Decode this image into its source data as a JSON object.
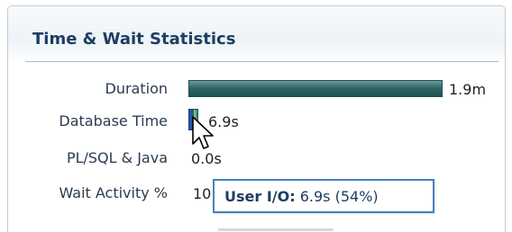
{
  "panel": {
    "title": "Time & Wait Statistics"
  },
  "rows": [
    {
      "label": "Duration",
      "value": "1.9m"
    },
    {
      "label": "Database Time",
      "value": "6.9s"
    },
    {
      "label": "PL/SQL & Java",
      "value": "0.0s"
    },
    {
      "label": "Wait Activity %",
      "value": "10"
    }
  ],
  "tooltip": {
    "label": "User I/O:",
    "value": "6.9s (54%)"
  },
  "colors": {
    "title": "#1e3e62",
    "duration_bar": "#2f6767",
    "user_io": "#1d57b2",
    "cpu": "#35a36a",
    "tooltip_border": "#4a7fc0"
  },
  "icons": {
    "cursor": "mouse-pointer-icon"
  }
}
